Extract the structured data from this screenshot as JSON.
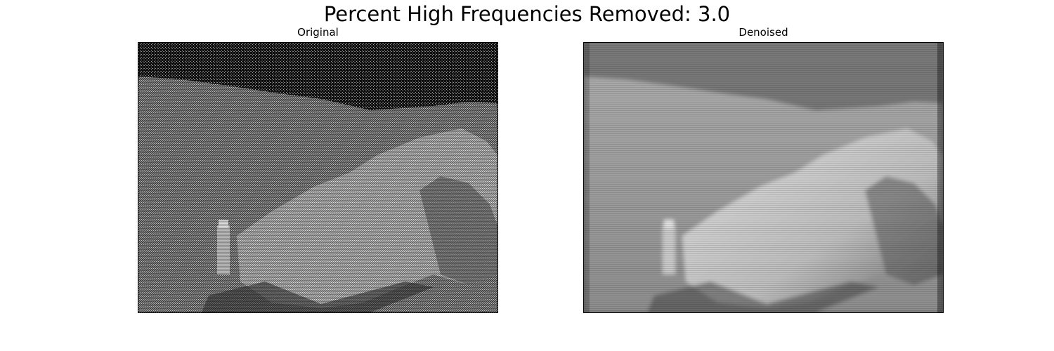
{
  "figure": {
    "suptitle": "Percent High Frequencies Removed: 3.0"
  },
  "panels": [
    {
      "title": "Original",
      "image": "noisy-grayscale-moon-rock-photo"
    },
    {
      "title": "Denoised",
      "image": "smoothed-grayscale-moon-rock-photo"
    }
  ],
  "colors": {
    "background": "#ffffff",
    "frame": "#000000"
  }
}
